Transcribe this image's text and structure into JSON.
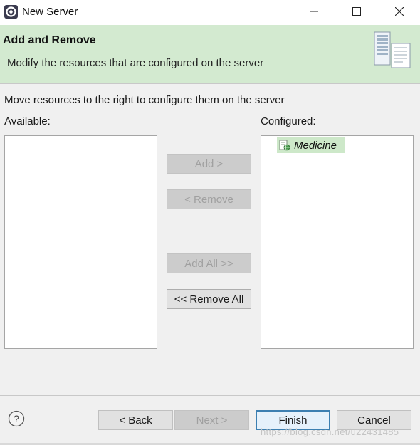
{
  "window": {
    "title": "New Server",
    "icon": "server-wizard-icon"
  },
  "header": {
    "title": "Add and Remove",
    "description": "Modify the resources that are configured on the server",
    "art_icon": "server-document-icon"
  },
  "main": {
    "instruction": "Move resources to the right to configure them on the server",
    "available_label": "Available:",
    "configured_label": "Configured:",
    "available_items": [],
    "configured_items": [
      {
        "label": "Medicine",
        "icon": "web-module-icon"
      }
    ],
    "buttons": {
      "add": "Add >",
      "remove": "< Remove",
      "add_all": "Add All >>",
      "remove_all": "<< Remove All"
    }
  },
  "footer": {
    "help_icon": "help-icon",
    "back": "< Back",
    "next": "Next >",
    "finish": "Finish",
    "cancel": "Cancel",
    "watermark": "https://blog.csdn.net/u22431485"
  },
  "colors": {
    "banner_bg": "#d3ead0",
    "selected_item_bg": "#cde8c9",
    "default_button_border": "#3c7fb1"
  }
}
